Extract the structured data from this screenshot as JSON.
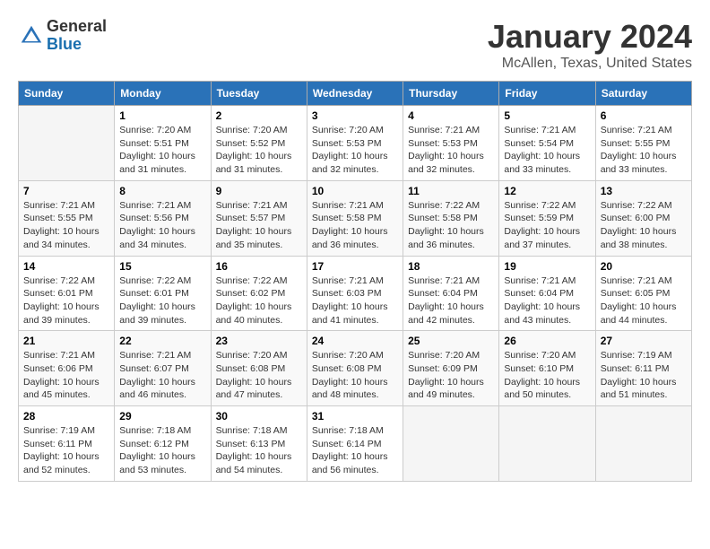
{
  "header": {
    "logo_general": "General",
    "logo_blue": "Blue",
    "month_title": "January 2024",
    "location": "McAllen, Texas, United States"
  },
  "days_of_week": [
    "Sunday",
    "Monday",
    "Tuesday",
    "Wednesday",
    "Thursday",
    "Friday",
    "Saturday"
  ],
  "weeks": [
    [
      {
        "day": "",
        "sunrise": "",
        "sunset": "",
        "daylight": "",
        "empty": true
      },
      {
        "day": "1",
        "sunrise": "Sunrise: 7:20 AM",
        "sunset": "Sunset: 5:51 PM",
        "daylight": "Daylight: 10 hours and 31 minutes.",
        "empty": false
      },
      {
        "day": "2",
        "sunrise": "Sunrise: 7:20 AM",
        "sunset": "Sunset: 5:52 PM",
        "daylight": "Daylight: 10 hours and 31 minutes.",
        "empty": false
      },
      {
        "day": "3",
        "sunrise": "Sunrise: 7:20 AM",
        "sunset": "Sunset: 5:53 PM",
        "daylight": "Daylight: 10 hours and 32 minutes.",
        "empty": false
      },
      {
        "day": "4",
        "sunrise": "Sunrise: 7:21 AM",
        "sunset": "Sunset: 5:53 PM",
        "daylight": "Daylight: 10 hours and 32 minutes.",
        "empty": false
      },
      {
        "day": "5",
        "sunrise": "Sunrise: 7:21 AM",
        "sunset": "Sunset: 5:54 PM",
        "daylight": "Daylight: 10 hours and 33 minutes.",
        "empty": false
      },
      {
        "day": "6",
        "sunrise": "Sunrise: 7:21 AM",
        "sunset": "Sunset: 5:55 PM",
        "daylight": "Daylight: 10 hours and 33 minutes.",
        "empty": false
      }
    ],
    [
      {
        "day": "7",
        "sunrise": "Sunrise: 7:21 AM",
        "sunset": "Sunset: 5:55 PM",
        "daylight": "Daylight: 10 hours and 34 minutes.",
        "empty": false
      },
      {
        "day": "8",
        "sunrise": "Sunrise: 7:21 AM",
        "sunset": "Sunset: 5:56 PM",
        "daylight": "Daylight: 10 hours and 34 minutes.",
        "empty": false
      },
      {
        "day": "9",
        "sunrise": "Sunrise: 7:21 AM",
        "sunset": "Sunset: 5:57 PM",
        "daylight": "Daylight: 10 hours and 35 minutes.",
        "empty": false
      },
      {
        "day": "10",
        "sunrise": "Sunrise: 7:21 AM",
        "sunset": "Sunset: 5:58 PM",
        "daylight": "Daylight: 10 hours and 36 minutes.",
        "empty": false
      },
      {
        "day": "11",
        "sunrise": "Sunrise: 7:22 AM",
        "sunset": "Sunset: 5:58 PM",
        "daylight": "Daylight: 10 hours and 36 minutes.",
        "empty": false
      },
      {
        "day": "12",
        "sunrise": "Sunrise: 7:22 AM",
        "sunset": "Sunset: 5:59 PM",
        "daylight": "Daylight: 10 hours and 37 minutes.",
        "empty": false
      },
      {
        "day": "13",
        "sunrise": "Sunrise: 7:22 AM",
        "sunset": "Sunset: 6:00 PM",
        "daylight": "Daylight: 10 hours and 38 minutes.",
        "empty": false
      }
    ],
    [
      {
        "day": "14",
        "sunrise": "Sunrise: 7:22 AM",
        "sunset": "Sunset: 6:01 PM",
        "daylight": "Daylight: 10 hours and 39 minutes.",
        "empty": false
      },
      {
        "day": "15",
        "sunrise": "Sunrise: 7:22 AM",
        "sunset": "Sunset: 6:01 PM",
        "daylight": "Daylight: 10 hours and 39 minutes.",
        "empty": false
      },
      {
        "day": "16",
        "sunrise": "Sunrise: 7:22 AM",
        "sunset": "Sunset: 6:02 PM",
        "daylight": "Daylight: 10 hours and 40 minutes.",
        "empty": false
      },
      {
        "day": "17",
        "sunrise": "Sunrise: 7:21 AM",
        "sunset": "Sunset: 6:03 PM",
        "daylight": "Daylight: 10 hours and 41 minutes.",
        "empty": false
      },
      {
        "day": "18",
        "sunrise": "Sunrise: 7:21 AM",
        "sunset": "Sunset: 6:04 PM",
        "daylight": "Daylight: 10 hours and 42 minutes.",
        "empty": false
      },
      {
        "day": "19",
        "sunrise": "Sunrise: 7:21 AM",
        "sunset": "Sunset: 6:04 PM",
        "daylight": "Daylight: 10 hours and 43 minutes.",
        "empty": false
      },
      {
        "day": "20",
        "sunrise": "Sunrise: 7:21 AM",
        "sunset": "Sunset: 6:05 PM",
        "daylight": "Daylight: 10 hours and 44 minutes.",
        "empty": false
      }
    ],
    [
      {
        "day": "21",
        "sunrise": "Sunrise: 7:21 AM",
        "sunset": "Sunset: 6:06 PM",
        "daylight": "Daylight: 10 hours and 45 minutes.",
        "empty": false
      },
      {
        "day": "22",
        "sunrise": "Sunrise: 7:21 AM",
        "sunset": "Sunset: 6:07 PM",
        "daylight": "Daylight: 10 hours and 46 minutes.",
        "empty": false
      },
      {
        "day": "23",
        "sunrise": "Sunrise: 7:20 AM",
        "sunset": "Sunset: 6:08 PM",
        "daylight": "Daylight: 10 hours and 47 minutes.",
        "empty": false
      },
      {
        "day": "24",
        "sunrise": "Sunrise: 7:20 AM",
        "sunset": "Sunset: 6:08 PM",
        "daylight": "Daylight: 10 hours and 48 minutes.",
        "empty": false
      },
      {
        "day": "25",
        "sunrise": "Sunrise: 7:20 AM",
        "sunset": "Sunset: 6:09 PM",
        "daylight": "Daylight: 10 hours and 49 minutes.",
        "empty": false
      },
      {
        "day": "26",
        "sunrise": "Sunrise: 7:20 AM",
        "sunset": "Sunset: 6:10 PM",
        "daylight": "Daylight: 10 hours and 50 minutes.",
        "empty": false
      },
      {
        "day": "27",
        "sunrise": "Sunrise: 7:19 AM",
        "sunset": "Sunset: 6:11 PM",
        "daylight": "Daylight: 10 hours and 51 minutes.",
        "empty": false
      }
    ],
    [
      {
        "day": "28",
        "sunrise": "Sunrise: 7:19 AM",
        "sunset": "Sunset: 6:11 PM",
        "daylight": "Daylight: 10 hours and 52 minutes.",
        "empty": false
      },
      {
        "day": "29",
        "sunrise": "Sunrise: 7:18 AM",
        "sunset": "Sunset: 6:12 PM",
        "daylight": "Daylight: 10 hours and 53 minutes.",
        "empty": false
      },
      {
        "day": "30",
        "sunrise": "Sunrise: 7:18 AM",
        "sunset": "Sunset: 6:13 PM",
        "daylight": "Daylight: 10 hours and 54 minutes.",
        "empty": false
      },
      {
        "day": "31",
        "sunrise": "Sunrise: 7:18 AM",
        "sunset": "Sunset: 6:14 PM",
        "daylight": "Daylight: 10 hours and 56 minutes.",
        "empty": false
      },
      {
        "day": "",
        "sunrise": "",
        "sunset": "",
        "daylight": "",
        "empty": true
      },
      {
        "day": "",
        "sunrise": "",
        "sunset": "",
        "daylight": "",
        "empty": true
      },
      {
        "day": "",
        "sunrise": "",
        "sunset": "",
        "daylight": "",
        "empty": true
      }
    ]
  ]
}
